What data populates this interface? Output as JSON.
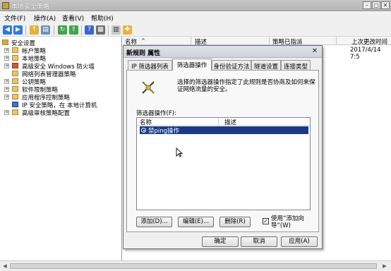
{
  "window": {
    "title": "本地安全策略"
  },
  "menu": [
    "文件(F)",
    "操作(A)",
    "查看(V)",
    "帮助(H)"
  ],
  "tree": {
    "root": "安全设置",
    "items": [
      "帐户策略",
      "本地策略",
      "高级安全 Windows 防火墙",
      "网络列表管理器策略",
      "公钥策略",
      "软件限制策略",
      "应用程序控制策略",
      "IP 安全策略，在 本地计算机",
      "高级审核策略配置"
    ]
  },
  "list": {
    "columns": [
      "名称",
      "描述",
      "策略已指派",
      "上次更改时间"
    ],
    "row_time": "2017/4/14 7:5"
  },
  "dialog": {
    "title": "新规则 属性",
    "tabs": [
      "IP 筛选器列表",
      "筛选器操作",
      "身份验证方法",
      "隧道设置",
      "连接类型"
    ],
    "active_tab": 1,
    "info": "选择的筛选器操作指定了此规则是否协商及如何来保证网络流量的安全。",
    "filter_label": "筛选器操作(F):",
    "columns": [
      "名称",
      "描述"
    ],
    "rows": [
      {
        "name": "禁ping操作",
        "selected": true
      }
    ],
    "buttons": {
      "add": "添加(D)...",
      "edit": "编辑(E)...",
      "remove": "删除(R)"
    },
    "checkbox": {
      "label": "使用“添加向导”(W)",
      "checked": true
    },
    "footer": {
      "ok": "确定",
      "cancel": "取消",
      "apply": "应用(A)"
    }
  }
}
